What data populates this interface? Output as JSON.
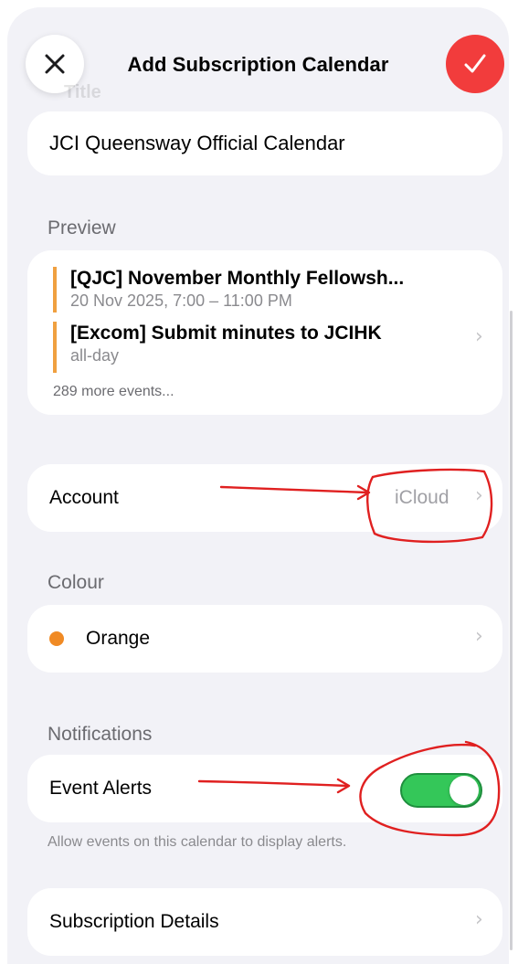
{
  "header": {
    "title": "Add Subscription Calendar",
    "ghost_label": "Title",
    "close_icon": "close-icon",
    "confirm_icon": "checkmark-icon"
  },
  "name_field": {
    "value": "JCI Queensway Official Calendar"
  },
  "preview": {
    "label": "Preview",
    "events": [
      {
        "title": "[QJC] November Monthly Fellowsh...",
        "time": "20 Nov 2025, 7:00 – 11:00 PM"
      },
      {
        "title": "[Excom] Submit minutes to JCIHK",
        "time": "all-day"
      }
    ],
    "more": "289 more events...",
    "accent": "#f0a040"
  },
  "account": {
    "label": "Account",
    "value": "iCloud"
  },
  "colour": {
    "section_label": "Colour",
    "value": "Orange",
    "swatch": "#f08a24"
  },
  "notifications": {
    "section_label": "Notifications",
    "event_alerts_label": "Event Alerts",
    "event_alerts_on": true,
    "footnote": "Allow events on this calendar to display alerts."
  },
  "subscription_details": {
    "label": "Subscription Details"
  },
  "colors": {
    "confirm": "#f23c3c",
    "toggle_on": "#34c759",
    "annotation": "#e02020"
  }
}
